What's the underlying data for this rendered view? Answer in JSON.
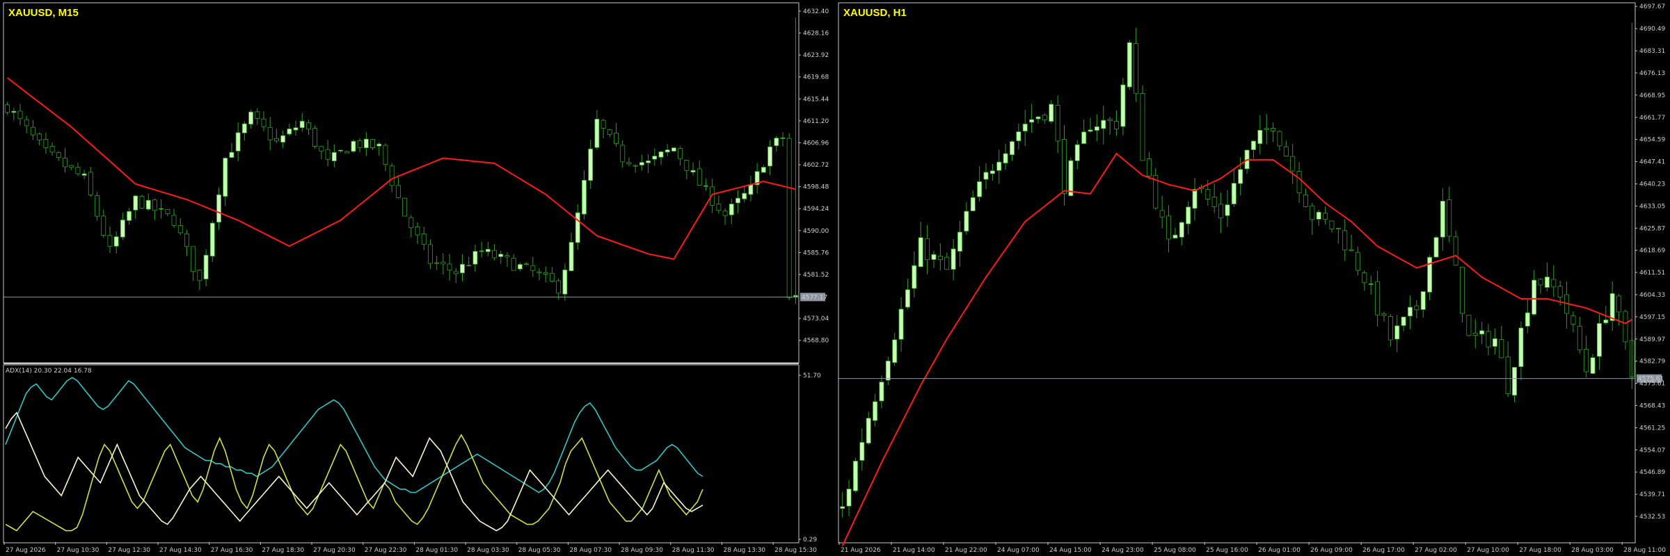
{
  "colors": {
    "background": "#000000",
    "frame": "#c8c8c8",
    "bull_body": "#c8ffb4",
    "bear_body": "#000000",
    "wick": "#2ea024",
    "moving_average": "#ff1a1a",
    "title": "#ffff00",
    "price_line": "#8c96a0",
    "adx_main": "#2ec8c8",
    "adx_plus_di": "#c8e640",
    "adx_minus_di": "#fff5d0"
  },
  "chart_data": [
    {
      "type": "candlestick",
      "title": "XAUUSD, M15",
      "ylim": [
        4565.0,
        4633.2
      ],
      "y_ticks": [
        "4632.40",
        "4628.16",
        "4623.92",
        "4619.68",
        "4615.44",
        "4611.20",
        "4606.96",
        "4602.72",
        "4598.48",
        "4594.24",
        "4590.00",
        "4585.76",
        "4581.52",
        "4577.17",
        "4573.04",
        "4568.80"
      ],
      "current_price": "4577.17",
      "current_price_value": 4577.17,
      "x_ticks": [
        "27 Aug 2026",
        "27 Aug 10:30",
        "27 Aug 12:30",
        "27 Aug 14:30",
        "27 Aug 16:30",
        "27 Aug 18:30",
        "27 Aug 20:30",
        "27 Aug 22:30",
        "28 Aug 01:30",
        "28 Aug 03:30",
        "28 Aug 05:30",
        "28 Aug 07:30",
        "28 Aug 09:30",
        "28 Aug 11:30",
        "28 Aug 13:30",
        "28 Aug 15:30"
      ],
      "candles_per_tick": 8,
      "candle_count": 124,
      "ma_anchors": [
        [
          0,
          4619.5
        ],
        [
          10,
          4610
        ],
        [
          20,
          4599
        ],
        [
          28,
          4596
        ],
        [
          36,
          4592
        ],
        [
          44,
          4587
        ],
        [
          52,
          4592
        ],
        [
          60,
          4600
        ],
        [
          68,
          4604
        ],
        [
          76,
          4603
        ],
        [
          84,
          4597
        ],
        [
          92,
          4589
        ],
        [
          100,
          4585.5
        ],
        [
          104,
          4584.5
        ],
        [
          110,
          4597
        ],
        [
          118,
          4599.5
        ],
        [
          123,
          4598
        ]
      ],
      "close_anchors": [
        [
          0,
          4614
        ],
        [
          6,
          4605
        ],
        [
          12,
          4600
        ],
        [
          16,
          4586
        ],
        [
          20,
          4596
        ],
        [
          26,
          4592
        ],
        [
          30,
          4580
        ],
        [
          34,
          4604
        ],
        [
          38,
          4612
        ],
        [
          42,
          4607
        ],
        [
          46,
          4611
        ],
        [
          50,
          4603
        ],
        [
          54,
          4607
        ],
        [
          58,
          4606
        ],
        [
          62,
          4593
        ],
        [
          66,
          4584
        ],
        [
          70,
          4582
        ],
        [
          74,
          4586
        ],
        [
          78,
          4584
        ],
        [
          82,
          4582
        ],
        [
          86,
          4579
        ],
        [
          88,
          4587
        ],
        [
          92,
          4611
        ],
        [
          96,
          4604
        ],
        [
          100,
          4603
        ],
        [
          104,
          4606
        ],
        [
          108,
          4599
        ],
        [
          112,
          4593
        ],
        [
          116,
          4598
        ],
        [
          119,
          4606
        ],
        [
          121,
          4608
        ],
        [
          122,
          4577
        ]
      ],
      "indicator": {
        "label": "ADX(14) 20.30 22.04 16.78",
        "y_ticks": [
          "51.70",
          "0.29"
        ],
        "ylim": [
          0.29,
          51.7
        ],
        "series": [
          {
            "role": "main",
            "values": [
              30,
              34,
              38,
              42,
              46,
              48,
              49,
              47,
              45,
              44,
              46,
              48,
              50,
              51,
              50,
              48,
              46,
              44,
              42,
              41,
              42,
              44,
              46,
              48,
              50,
              49,
              47,
              45,
              43,
              41,
              39,
              37,
              35,
              33,
              31,
              29,
              28,
              27,
              26,
              25,
              25,
              24,
              24,
              23,
              23,
              22,
              22,
              21,
              21,
              20,
              21,
              22,
              23,
              25,
              27,
              29,
              31,
              33,
              35,
              37,
              39,
              41,
              42,
              43,
              44,
              43,
              41,
              38,
              35,
              32,
              29,
              26,
              23,
              21,
              19,
              18,
              17,
              16,
              16,
              15,
              15,
              16,
              17,
              18,
              19,
              20,
              21,
              22,
              23,
              24,
              25,
              26,
              27,
              26,
              25,
              24,
              23,
              22,
              21,
              20,
              19,
              18,
              17,
              16,
              15,
              16,
              18,
              21,
              25,
              29,
              33,
              37,
              40,
              42,
              43,
              41,
              38,
              35,
              32,
              29,
              27,
              25,
              23,
              22,
              22,
              23,
              24,
              25,
              27,
              29,
              30,
              29,
              27,
              25,
              23,
              21,
              20
            ]
          },
          {
            "role": "plus_di",
            "values": [
              5,
              4,
              3,
              5,
              7,
              9,
              8,
              7,
              6,
              5,
              4,
              3,
              3,
              4,
              8,
              14,
              20,
              26,
              30,
              28,
              24,
              20,
              16,
              12,
              10,
              12,
              16,
              20,
              24,
              28,
              30,
              26,
              22,
              18,
              14,
              12,
              16,
              22,
              28,
              32,
              28,
              22,
              16,
              12,
              10,
              14,
              20,
              26,
              30,
              28,
              24,
              20,
              16,
              12,
              10,
              8,
              10,
              14,
              18,
              22,
              26,
              30,
              28,
              24,
              20,
              16,
              12,
              10,
              14,
              18,
              16,
              12,
              10,
              8,
              6,
              5,
              7,
              10,
              14,
              18,
              22,
              26,
              30,
              33,
              30,
              26,
              22,
              18,
              16,
              14,
              12,
              10,
              8,
              7,
              6,
              5,
              5,
              6,
              8,
              10,
              14,
              18,
              24,
              28,
              30,
              32,
              28,
              24,
              20,
              16,
              12,
              10,
              8,
              6,
              6,
              8,
              10,
              14,
              18,
              22,
              18,
              14,
              12,
              10,
              8,
              10,
              12,
              16
            ]
          },
          {
            "role": "minus_di",
            "values": [
              35,
              38,
              40,
              36,
              32,
              28,
              24,
              20,
              18,
              16,
              14,
              18,
              22,
              26,
              24,
              22,
              20,
              18,
              22,
              26,
              30,
              26,
              22,
              18,
              14,
              12,
              10,
              8,
              6,
              5,
              7,
              10,
              13,
              16,
              18,
              20,
              18,
              16,
              14,
              12,
              10,
              8,
              6,
              8,
              10,
              12,
              14,
              16,
              18,
              20,
              18,
              16,
              14,
              12,
              10,
              12,
              14,
              16,
              18,
              16,
              14,
              12,
              10,
              8,
              10,
              12,
              14,
              16,
              18,
              22,
              26,
              24,
              22,
              20,
              24,
              28,
              32,
              30,
              28,
              24,
              20,
              16,
              12,
              10,
              8,
              6,
              5,
              4,
              3,
              4,
              6,
              10,
              14,
              18,
              22,
              20,
              18,
              16,
              14,
              12,
              10,
              8,
              10,
              12,
              14,
              16,
              18,
              20,
              22,
              20,
              18,
              16,
              14,
              12,
              10,
              8,
              10,
              14,
              18,
              16,
              14,
              12,
              10,
              9,
              10,
              11
            ]
          }
        ]
      }
    },
    {
      "type": "candlestick",
      "title": "XAUUSD, H1",
      "ylim": [
        4526.0,
        4697.5
      ],
      "y_ticks": [
        "4697.67",
        "4690.49",
        "4683.31",
        "4676.13",
        "4668.95",
        "4661.77",
        "4654.59",
        "4647.41",
        "4640.23",
        "4633.05",
        "4625.87",
        "4618.69",
        "4611.51",
        "4604.33",
        "4597.15",
        "4589.97",
        "4582.79",
        "4575.61",
        "4568.43",
        "4561.25",
        "4554.07",
        "4546.89",
        "4539.71",
        "4532.53"
      ],
      "current_price": "4575.61",
      "current_price_value": 4577.17,
      "x_ticks": [
        "21 Aug 2026",
        "21 Aug 14:00",
        "21 Aug 22:00",
        "24 Aug 07:00",
        "24 Aug 15:00",
        "24 Aug 23:00",
        "25 Aug 08:00",
        "25 Aug 16:00",
        "26 Aug 01:00",
        "26 Aug 09:00",
        "26 Aug 17:00",
        "27 Aug 02:00",
        "27 Aug 10:00",
        "27 Aug 18:00",
        "28 Aug 03:00",
        "28 Aug 11:00"
      ],
      "candles_per_tick": 8,
      "candle_count": 122,
      "ma_anchors": [
        [
          0,
          4523
        ],
        [
          6,
          4550
        ],
        [
          12,
          4575
        ],
        [
          16,
          4590
        ],
        [
          22,
          4610
        ],
        [
          28,
          4628
        ],
        [
          34,
          4638
        ],
        [
          38,
          4637
        ],
        [
          42,
          4650
        ],
        [
          46,
          4643
        ],
        [
          50,
          4640
        ],
        [
          54,
          4638
        ],
        [
          58,
          4642
        ],
        [
          62,
          4648
        ],
        [
          66,
          4648
        ],
        [
          70,
          4642
        ],
        [
          74,
          4634
        ],
        [
          78,
          4628
        ],
        [
          82,
          4620
        ],
        [
          88,
          4613
        ],
        [
          94,
          4617
        ],
        [
          98,
          4610
        ],
        [
          104,
          4603
        ],
        [
          108,
          4603
        ],
        [
          114,
          4600
        ],
        [
          120,
          4595
        ],
        [
          124,
          4600
        ],
        [
          128,
          4596
        ]
      ],
      "close_anchors": [
        [
          0,
          4535
        ],
        [
          4,
          4565
        ],
        [
          8,
          4592
        ],
        [
          12,
          4620
        ],
        [
          16,
          4612
        ],
        [
          20,
          4635
        ],
        [
          24,
          4650
        ],
        [
          28,
          4660
        ],
        [
          32,
          4665
        ],
        [
          34,
          4640
        ],
        [
          38,
          4660
        ],
        [
          42,
          4660
        ],
        [
          44,
          4685
        ],
        [
          46,
          4650
        ],
        [
          50,
          4620
        ],
        [
          54,
          4640
        ],
        [
          58,
          4630
        ],
        [
          62,
          4650
        ],
        [
          66,
          4660
        ],
        [
          68,
          4650
        ],
        [
          72,
          4630
        ],
        [
          76,
          4625
        ],
        [
          80,
          4610
        ],
        [
          84,
          4590
        ],
        [
          88,
          4600
        ],
        [
          92,
          4633
        ],
        [
          96,
          4590
        ],
        [
          100,
          4590
        ],
        [
          102,
          4575
        ],
        [
          106,
          4610
        ],
        [
          110,
          4605
        ],
        [
          114,
          4580
        ],
        [
          118,
          4605
        ],
        [
          121,
          4578
        ]
      ],
      "indicator": null
    }
  ]
}
